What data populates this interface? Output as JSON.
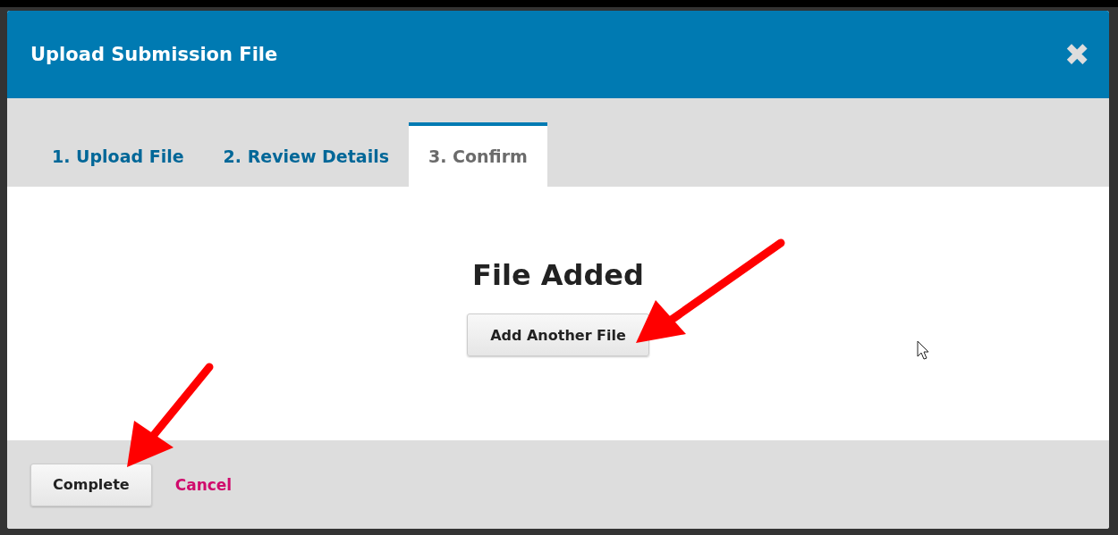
{
  "modal": {
    "title": "Upload Submission File",
    "close": "✖"
  },
  "tabs": [
    {
      "label": "1. Upload File",
      "selected": false
    },
    {
      "label": "2. Review Details",
      "selected": false
    },
    {
      "label": "3. Confirm",
      "selected": true
    }
  ],
  "content": {
    "heading": "File Added",
    "button": "Add Another File"
  },
  "footer": {
    "primary": "Complete",
    "cancel": "Cancel"
  }
}
